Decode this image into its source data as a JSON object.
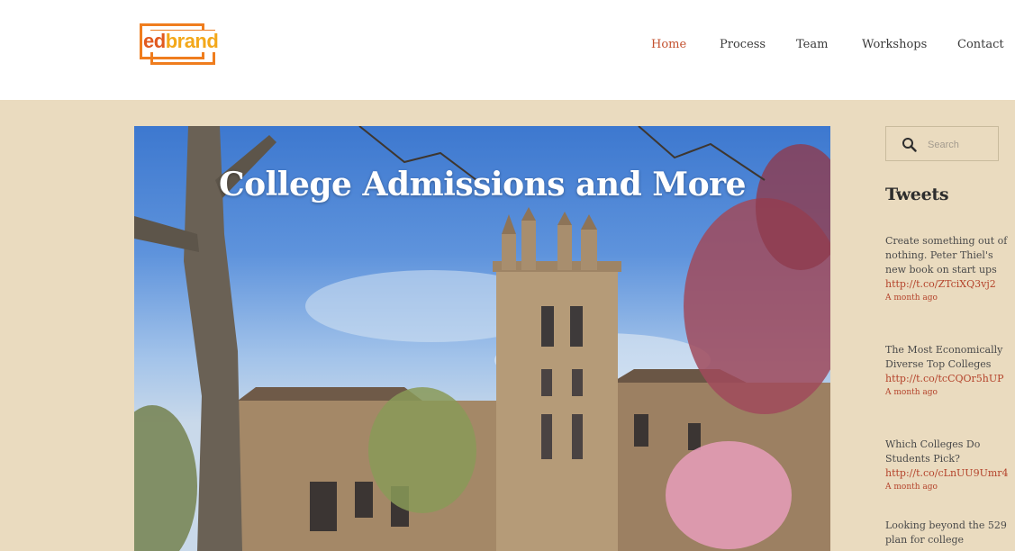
{
  "header": {
    "logo": {
      "part1": "ed",
      "part2": "brand"
    },
    "nav": [
      {
        "label": "Home",
        "active": true
      },
      {
        "label": "Process",
        "active": false
      },
      {
        "label": "Team",
        "active": false
      },
      {
        "label": "Workshops",
        "active": false
      },
      {
        "label": "Contact",
        "active": false
      }
    ]
  },
  "hero": {
    "title": "College Admissions and More"
  },
  "sidebar": {
    "search": {
      "placeholder": "Search",
      "value": ""
    },
    "tweets_heading": "Tweets",
    "tweets": [
      {
        "text": "Create something out of nothing. Peter Thiel's new book on start ups",
        "link": "http://t.co/ZTciXQ3vj2",
        "time": "A month ago"
      },
      {
        "text": "The Most Economically Diverse Top Colleges",
        "link": "http://t.co/tcCQOr5hUP",
        "time": "A month ago"
      },
      {
        "text": "Which Colleges Do Students Pick?",
        "link": "http://t.co/cLnUU9Umr4",
        "time": "A month ago"
      },
      {
        "text": "Looking beyond the 529 plan for college",
        "link": "",
        "time": ""
      }
    ]
  },
  "colors": {
    "page_bg": "#eadbbf",
    "accent": "#b4432b",
    "logo_orange": "#ef7d1e"
  }
}
